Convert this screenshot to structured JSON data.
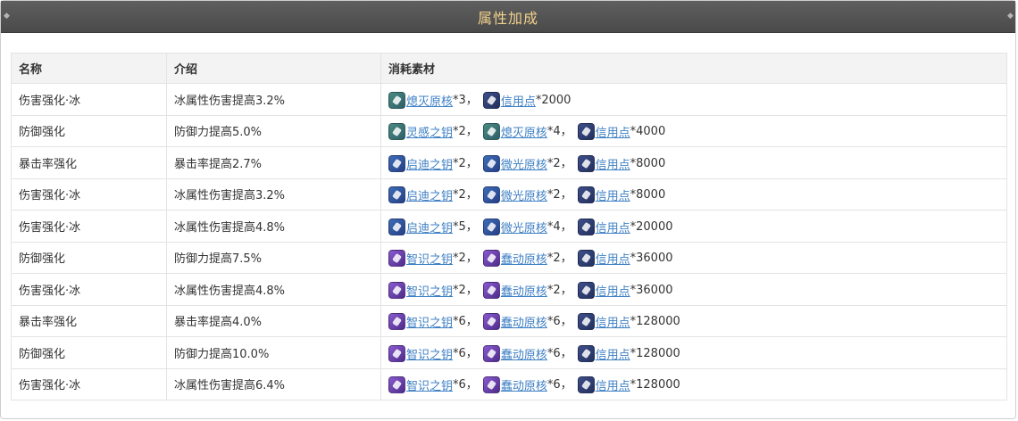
{
  "header": {
    "title": "属性加成"
  },
  "table": {
    "columns": [
      "名称",
      "介绍",
      "消耗素材"
    ],
    "rows": [
      {
        "name": "伤害强化·冰",
        "desc": "冰属性伤害提高3.2%",
        "materials": [
          {
            "icon": "destruction-core-icon",
            "color": "green",
            "label": "熄灭原核",
            "qty": "*3"
          },
          {
            "icon": "credit-icon",
            "color": "navy",
            "label": "信用点",
            "qty": "*2000"
          }
        ]
      },
      {
        "name": "防御强化",
        "desc": "防御力提高5.0%",
        "materials": [
          {
            "icon": "inspiration-key-icon",
            "color": "green",
            "label": "灵感之钥",
            "qty": "*2"
          },
          {
            "icon": "destruction-core-icon",
            "color": "green",
            "label": "熄灭原核",
            "qty": "*4"
          },
          {
            "icon": "credit-icon",
            "color": "navy",
            "label": "信用点",
            "qty": "*4000"
          }
        ]
      },
      {
        "name": "暴击率强化",
        "desc": "暴击率提高2.7%",
        "materials": [
          {
            "icon": "key-of-enlightenment-icon",
            "color": "blue",
            "label": "启迪之钥",
            "qty": "*2"
          },
          {
            "icon": "glimmering-core-icon",
            "color": "blue",
            "label": "微光原核",
            "qty": "*2"
          },
          {
            "icon": "credit-icon",
            "color": "navy",
            "label": "信用点",
            "qty": "*8000"
          }
        ]
      },
      {
        "name": "伤害强化·冰",
        "desc": "冰属性伤害提高3.2%",
        "materials": [
          {
            "icon": "key-of-enlightenment-icon",
            "color": "blue",
            "label": "启迪之钥",
            "qty": "*2"
          },
          {
            "icon": "glimmering-core-icon",
            "color": "blue",
            "label": "微光原核",
            "qty": "*2"
          },
          {
            "icon": "credit-icon",
            "color": "navy",
            "label": "信用点",
            "qty": "*8000"
          }
        ]
      },
      {
        "name": "伤害强化·冰",
        "desc": "冰属性伤害提高4.8%",
        "materials": [
          {
            "icon": "key-of-enlightenment-icon",
            "color": "blue",
            "label": "启迪之钥",
            "qty": "*5"
          },
          {
            "icon": "glimmering-core-icon",
            "color": "blue",
            "label": "微光原核",
            "qty": "*4"
          },
          {
            "icon": "credit-icon",
            "color": "navy",
            "label": "信用点",
            "qty": "*20000"
          }
        ]
      },
      {
        "name": "防御强化",
        "desc": "防御力提高7.5%",
        "materials": [
          {
            "icon": "key-of-wisdom-icon",
            "color": "purple",
            "label": "智识之钥",
            "qty": "*2"
          },
          {
            "icon": "squirming-core-icon",
            "color": "purple",
            "label": "蠢动原核",
            "qty": "*2"
          },
          {
            "icon": "credit-icon",
            "color": "navy",
            "label": "信用点",
            "qty": "*36000"
          }
        ]
      },
      {
        "name": "伤害强化·冰",
        "desc": "冰属性伤害提高4.8%",
        "materials": [
          {
            "icon": "key-of-wisdom-icon",
            "color": "purple",
            "label": "智识之钥",
            "qty": "*2"
          },
          {
            "icon": "squirming-core-icon",
            "color": "purple",
            "label": "蠢动原核",
            "qty": "*2"
          },
          {
            "icon": "credit-icon",
            "color": "navy",
            "label": "信用点",
            "qty": "*36000"
          }
        ]
      },
      {
        "name": "暴击率强化",
        "desc": "暴击率提高4.0%",
        "materials": [
          {
            "icon": "key-of-wisdom-icon",
            "color": "purple",
            "label": "智识之钥",
            "qty": "*6"
          },
          {
            "icon": "squirming-core-icon",
            "color": "purple",
            "label": "蠢动原核",
            "qty": "*6"
          },
          {
            "icon": "credit-icon",
            "color": "navy",
            "label": "信用点",
            "qty": "*128000"
          }
        ]
      },
      {
        "name": "防御强化",
        "desc": "防御力提高10.0%",
        "materials": [
          {
            "icon": "key-of-wisdom-icon",
            "color": "purple",
            "label": "智识之钥",
            "qty": "*6"
          },
          {
            "icon": "squirming-core-icon",
            "color": "purple",
            "label": "蠢动原核",
            "qty": "*6"
          },
          {
            "icon": "credit-icon",
            "color": "navy",
            "label": "信用点",
            "qty": "*128000"
          }
        ]
      },
      {
        "name": "伤害强化·冰",
        "desc": "冰属性伤害提高6.4%",
        "materials": [
          {
            "icon": "key-of-wisdom-icon",
            "color": "purple",
            "label": "智识之钥",
            "qty": "*6"
          },
          {
            "icon": "squirming-core-icon",
            "color": "purple",
            "label": "蠢动原核",
            "qty": "*6"
          },
          {
            "icon": "credit-icon",
            "color": "navy",
            "label": "信用点",
            "qty": "*128000"
          }
        ]
      }
    ]
  },
  "colors": {
    "header_bg": "#4f4f4f",
    "title": "#f1d18a",
    "link": "#3d7fc4"
  }
}
